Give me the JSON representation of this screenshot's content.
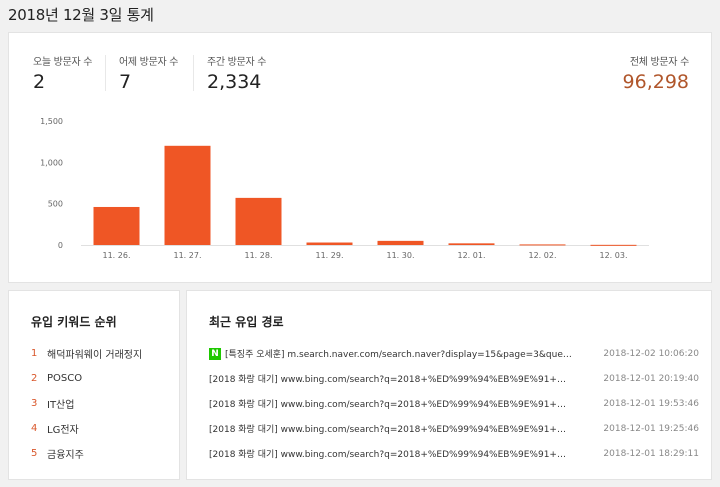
{
  "page": {
    "title": "2018년 12월 3일 통계"
  },
  "stats": {
    "today": {
      "label": "오늘 방문자 수",
      "value": "2"
    },
    "yesterday": {
      "label": "어제 방문자 수",
      "value": "7"
    },
    "week": {
      "label": "주간 방문자 수",
      "value": "2,334"
    },
    "total": {
      "label": "전체 방문자 수",
      "value": "96,298"
    }
  },
  "colors": {
    "bar": "#ef5625",
    "accent": "#b0562b",
    "rank": "#d9572b",
    "naver": "#1ec800"
  },
  "chart_data": {
    "type": "bar",
    "categories": [
      "11. 26.",
      "11. 27.",
      "11. 28.",
      "11. 29.",
      "11. 30.",
      "12. 01.",
      "12. 02.",
      "12. 03."
    ],
    "values": [
      460,
      1200,
      570,
      30,
      50,
      20,
      7,
      2
    ],
    "ylim": [
      0,
      1500
    ],
    "yticks": [
      0,
      500,
      1000,
      1500
    ],
    "ytick_labels": [
      "0",
      "500",
      "1,000",
      "1,500"
    ],
    "grid": false
  },
  "keywords": {
    "title": "유입 키워드 순위",
    "items": [
      {
        "rank": "1",
        "text": "해덕파워웨이 거래정지"
      },
      {
        "rank": "2",
        "text": "POSCO"
      },
      {
        "rank": "3",
        "text": "IT산업"
      },
      {
        "rank": "4",
        "text": "LG전자"
      },
      {
        "rank": "5",
        "text": "금융지주"
      }
    ]
  },
  "referrers": {
    "title": "최근 유입 경로",
    "items": [
      {
        "icon": "N",
        "text": "[특징주 오세훈] m.search.naver.com/search.naver?display=15&page=3&query=…",
        "time": "2018-12-02 10:06:20"
      },
      {
        "text": "[2018 화랑 대기] www.bing.com/search?q=2018+%ED%99%94%EB%9E%91+%…",
        "time": "2018-12-01 20:19:40"
      },
      {
        "text": "[2018 화랑 대기] www.bing.com/search?q=2018+%ED%99%94%EB%9E%91+%…",
        "time": "2018-12-01 19:53:46"
      },
      {
        "text": "[2018 화랑 대기] www.bing.com/search?q=2018+%ED%99%94%EB%9E%91+%…",
        "time": "2018-12-01 19:25:46"
      },
      {
        "text": "[2018 화랑 대기] www.bing.com/search?q=2018+%ED%99%94%EB%9E%91+%…",
        "time": "2018-12-01 18:29:11"
      }
    ]
  }
}
